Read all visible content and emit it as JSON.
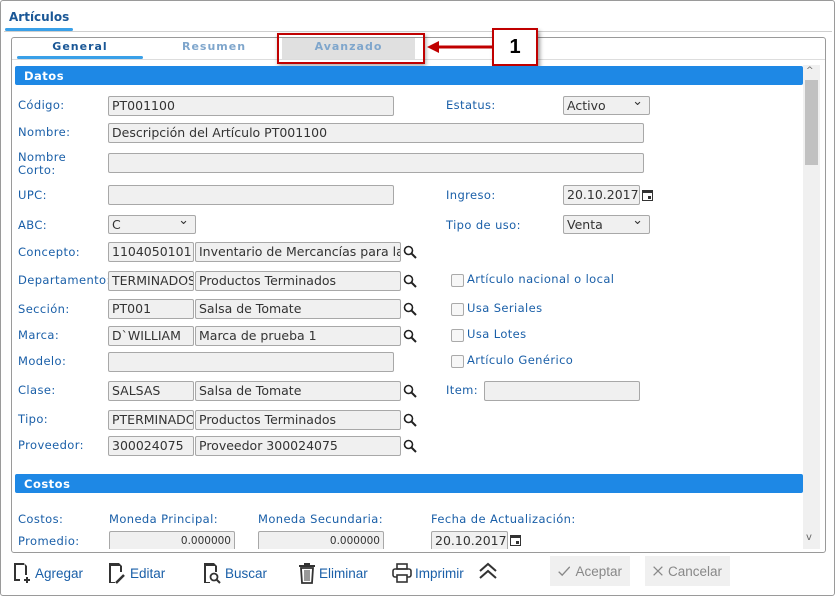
{
  "window": {
    "tab": "Artículos"
  },
  "tabs": [
    {
      "label": "General"
    },
    {
      "label": "Resumen"
    },
    {
      "label": "Avanzado"
    }
  ],
  "annotation": {
    "number": "1"
  },
  "datos": {
    "title": "Datos",
    "codigo": {
      "label": "Código:",
      "value": "PT001100"
    },
    "estatus": {
      "label": "Estatus:",
      "value": "Activo"
    },
    "nombre": {
      "label": "Nombre:",
      "value": "Descripción del Artículo PT001100"
    },
    "nombre_corto": {
      "label": "Nombre Corto:",
      "value": ""
    },
    "upc": {
      "label": "UPC:",
      "value": ""
    },
    "ingreso": {
      "label": "Ingreso:",
      "value": "20.10.2017"
    },
    "abc": {
      "label": "ABC:",
      "value": "C"
    },
    "tipo_uso": {
      "label": "Tipo de uso:",
      "value": "Venta"
    },
    "concepto": {
      "label": "Concepto:",
      "code": "1104050101",
      "desc": "Inventario de Mercancías para la"
    },
    "departamento": {
      "label": "Departamento:",
      "code": "TERMINADOS",
      "desc": "Productos Terminados"
    },
    "seccion": {
      "label": "Sección:",
      "code": "PT001",
      "desc": "Salsa de Tomate"
    },
    "marca": {
      "label": "Marca:",
      "code": "D`WILLIAM",
      "desc": "Marca de prueba 1"
    },
    "modelo": {
      "label": "Modelo:",
      "value": ""
    },
    "clase": {
      "label": "Clase:",
      "code": "SALSAS",
      "desc": "Salsa de Tomate"
    },
    "tipo": {
      "label": "Tipo:",
      "code": "PTERMINADOS",
      "desc": "Productos Terminados"
    },
    "proveedor": {
      "label": "Proveedor:",
      "code": "300024075",
      "desc": "Proveedor 300024075"
    },
    "checks": [
      {
        "label": "Artículo nacional o local",
        "checked": false
      },
      {
        "label": "Usa Seriales",
        "checked": false
      },
      {
        "label": "Usa Lotes",
        "checked": false
      },
      {
        "label": "Artículo Genérico",
        "checked": false
      }
    ],
    "item": {
      "label": "Item:",
      "value": ""
    }
  },
  "costos": {
    "title": "Costos",
    "row_label": "Costos:",
    "promedio": "Promedio:",
    "moneda_principal": "Moneda Principal:",
    "moneda_secundaria": "Moneda Secundaria:",
    "fecha_act": "Fecha de Actualización:",
    "principal_value": "0.000000",
    "secundaria_value": "0.000000",
    "fecha_value": "20.10.2017"
  },
  "toolbar": {
    "agregar": "Agregar",
    "editar": "Editar",
    "buscar": "Buscar",
    "eliminar": "Eliminar",
    "imprimir": "Imprimir",
    "aceptar": "Aceptar",
    "cancelar": "Cancelar"
  }
}
